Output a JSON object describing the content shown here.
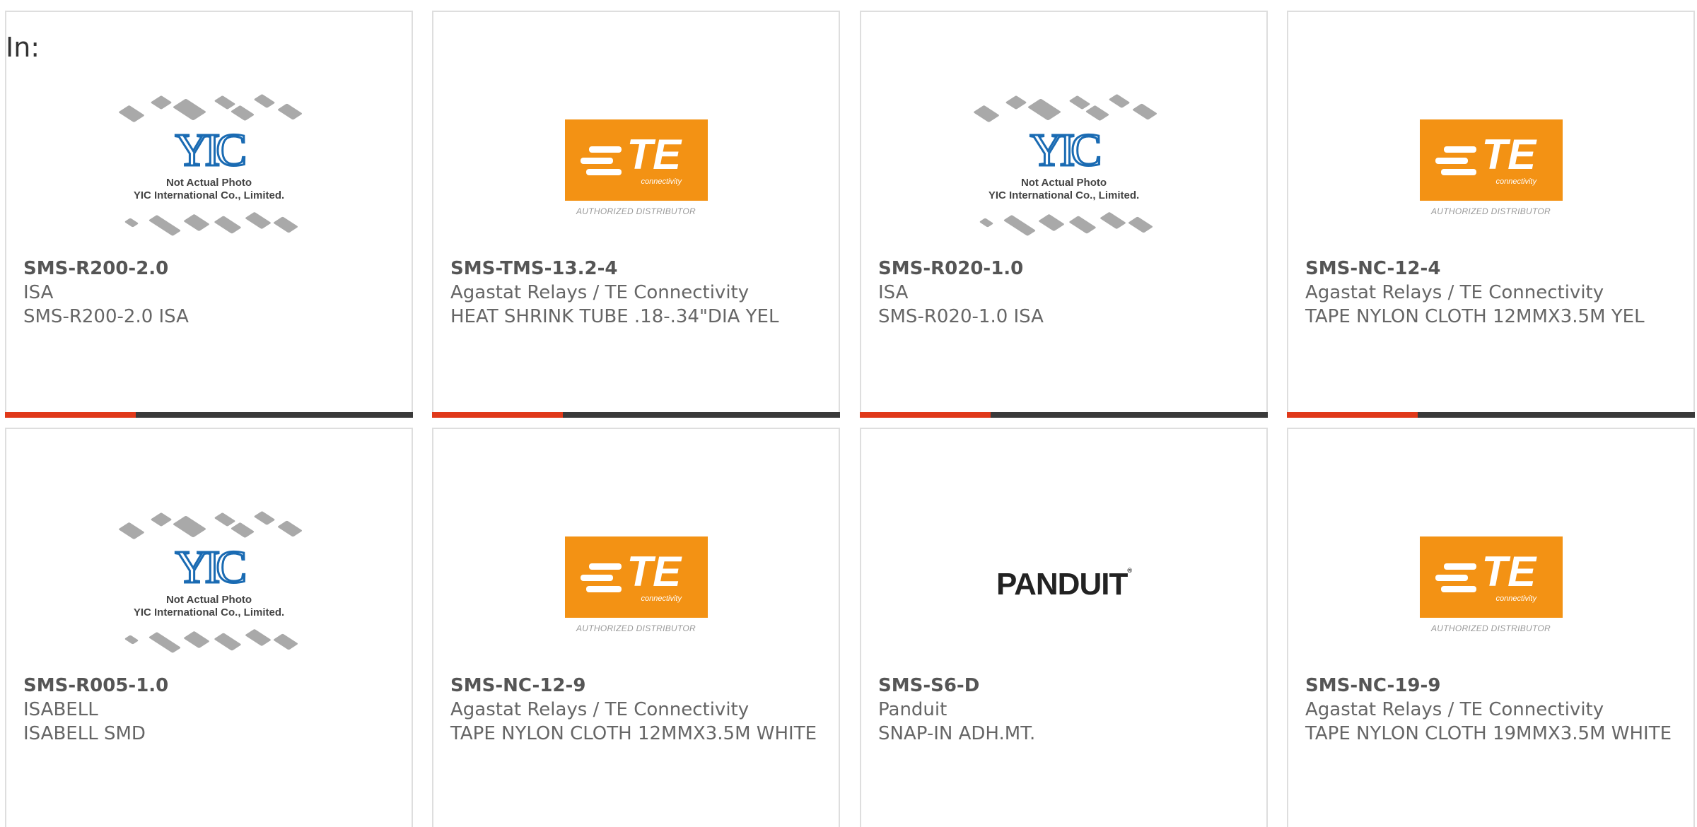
{
  "page_label": "In:",
  "brand_colors": {
    "accent": "#e0391a",
    "bar_track": "#3a3a3a",
    "te_orange": "#f39214",
    "yic_blue": "#1a6bb3"
  },
  "cards": [
    {
      "logo": "yic",
      "part": "SMS-R200-2.0",
      "mfr": "ISA",
      "desc": "SMS-R200-2.0 ISA",
      "progress": 0.32
    },
    {
      "logo": "te",
      "part": "SMS-TMS-13.2-4",
      "mfr": "Agastat Relays / TE Connectivity",
      "desc": "HEAT SHRINK TUBE .18-.34\"DIA YEL",
      "progress": 0.32
    },
    {
      "logo": "yic",
      "part": "SMS-R020-1.0",
      "mfr": "ISA",
      "desc": "SMS-R020-1.0 ISA",
      "progress": 0.32
    },
    {
      "logo": "te",
      "part": "SMS-NC-12-4",
      "mfr": "Agastat Relays / TE Connectivity",
      "desc": "TAPE NYLON CLOTH 12MMX3.5M YEL",
      "progress": 0.32
    },
    {
      "logo": "yic",
      "part": "SMS-R005-1.0",
      "mfr": "ISABELL",
      "desc": "ISABELL SMD"
    },
    {
      "logo": "te",
      "part": "SMS-NC-12-9",
      "mfr": "Agastat Relays / TE Connectivity",
      "desc": "TAPE NYLON CLOTH 12MMX3.5M WHITE"
    },
    {
      "logo": "panduit",
      "part": "SMS-S6-D",
      "mfr": "Panduit",
      "desc": "SNAP-IN ADH.MT."
    },
    {
      "logo": "te",
      "part": "SMS-NC-19-9",
      "mfr": "Agastat Relays / TE Connectivity",
      "desc": "TAPE NYLON CLOTH 19MMX3.5M WHITE"
    }
  ],
  "logos": {
    "te": {
      "word": "TE",
      "sub": "connectivity",
      "auth": "AUTHORIZED DISTRIBUTOR"
    },
    "yic": {
      "mark": "YIC",
      "line1": "Not Actual Photo",
      "line2": "YIC International Co., Limited."
    },
    "panduit": {
      "word": "PANDUIT",
      "mark": "®"
    }
  }
}
